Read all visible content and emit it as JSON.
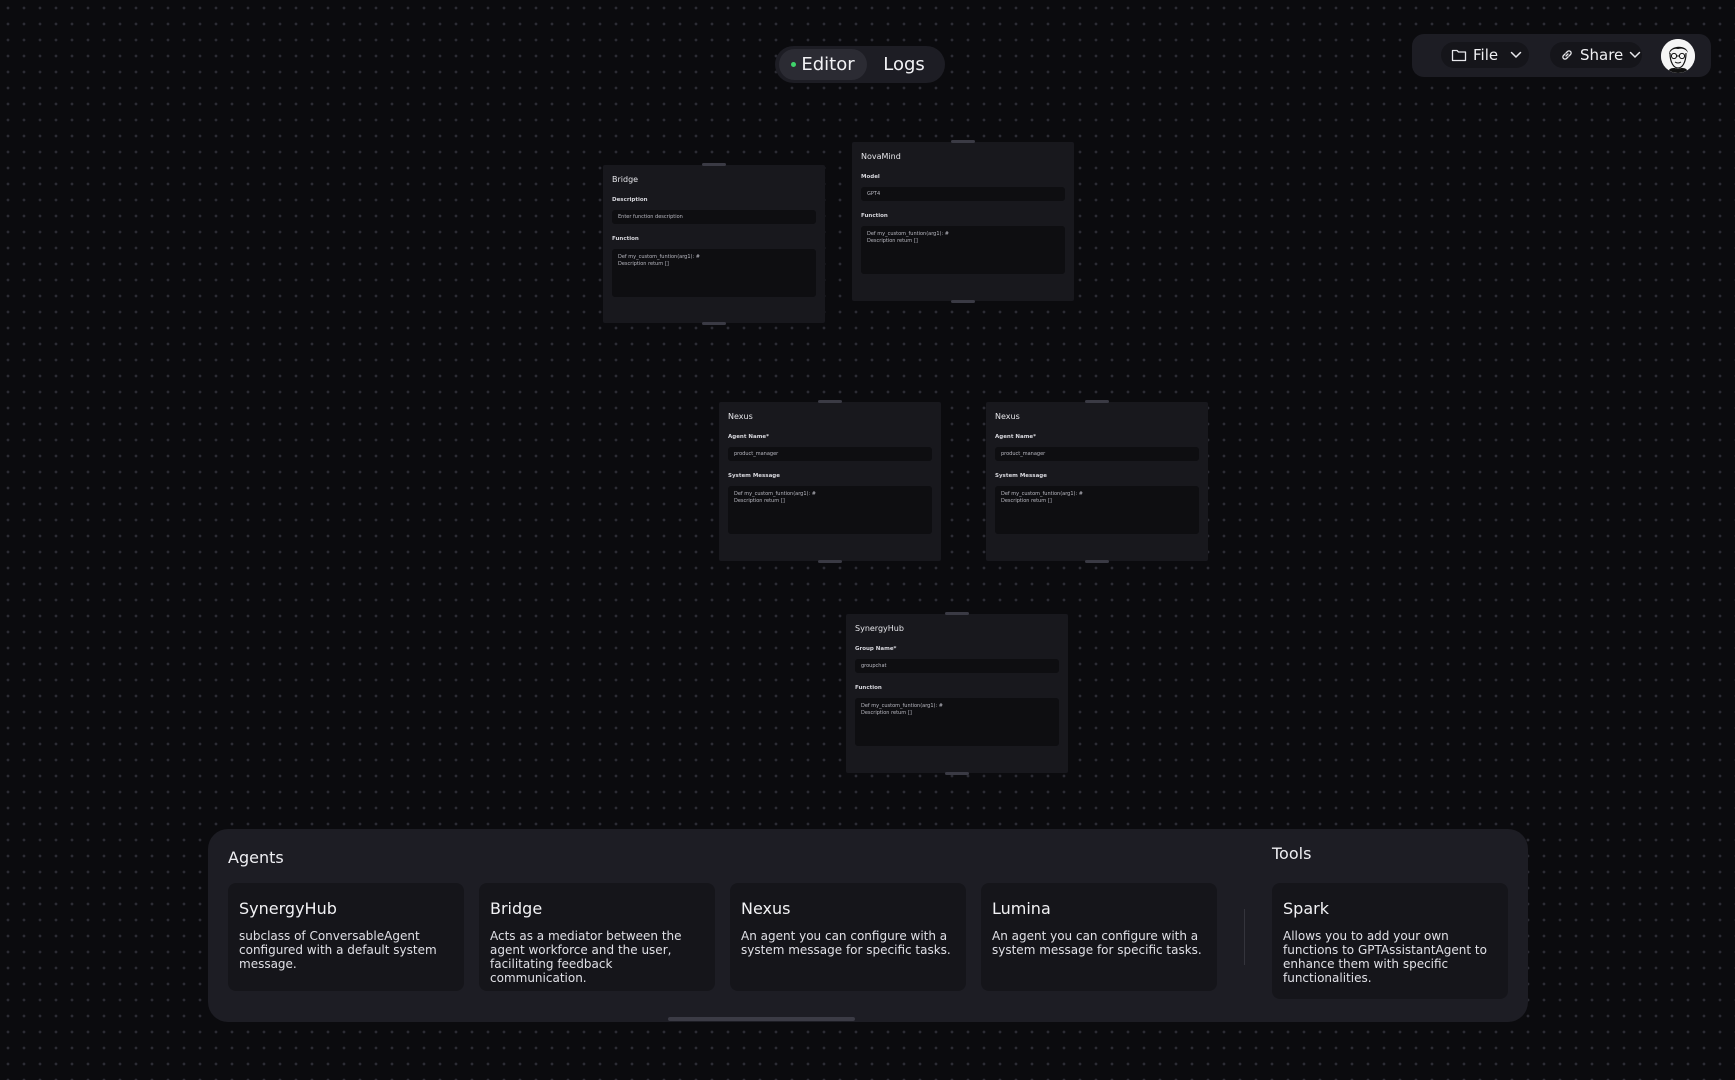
{
  "tabs": {
    "editor": "Editor",
    "logs": "Logs",
    "active_indicator_color": "#3fd46b"
  },
  "toolbar": {
    "file_label": "File",
    "share_label": "Share"
  },
  "nodes": {
    "bridge": {
      "title": "Bridge",
      "field1_label": "Description",
      "field1_value": "Enter function description",
      "field2_label": "Function",
      "field2_line1": "Def my_custom_funtion(arg1): #",
      "field2_line2": "Description return []"
    },
    "novamind": {
      "title": "NovaMind",
      "field1_label": "Model",
      "field1_value": "GPT4",
      "field2_label": "Function",
      "field2_line1": "Def my_custom_funtion(arg1): #",
      "field2_line2": "Description return []"
    },
    "nexus1": {
      "title": "Nexus",
      "field1_label": "Agent Name*",
      "field1_value": "product_manager",
      "field2_label": "System Message",
      "field2_line1": "Def my_custom_funtion(arg1): #",
      "field2_line2": "Description return []"
    },
    "nexus2": {
      "title": "Nexus",
      "field1_label": "Agent Name*",
      "field1_value": "product_manager",
      "field2_label": "System Message",
      "field2_line1": "Def my_custom_funtion(arg1): #",
      "field2_line2": "Description return []"
    },
    "synergyhub": {
      "title": "SynergyHub",
      "field1_label": "Group Name*",
      "field1_value": "groupchat",
      "field2_label": "Function",
      "field2_line1": "Def my_custom_funtion(arg1): #",
      "field2_line2": "Description return []"
    }
  },
  "panel": {
    "agents_heading": "Agents",
    "tools_heading": "Tools",
    "agents": [
      {
        "title": "SynergyHub",
        "desc": "subclass of ConversableAgent configured with a default system message."
      },
      {
        "title": "Bridge",
        "desc": "Acts as a mediator between the agent workforce and the user, facilitating feedback communication."
      },
      {
        "title": "Nexus",
        "desc": "An agent you can configure with a system message for specific tasks."
      },
      {
        "title": "Lumina",
        "desc": "An agent you can configure with a system message for specific tasks."
      }
    ],
    "tools": [
      {
        "title": "Spark",
        "desc": "Allows you to add your own functions to GPTAssistantAgent to enhance them with specific functionalities."
      }
    ]
  }
}
